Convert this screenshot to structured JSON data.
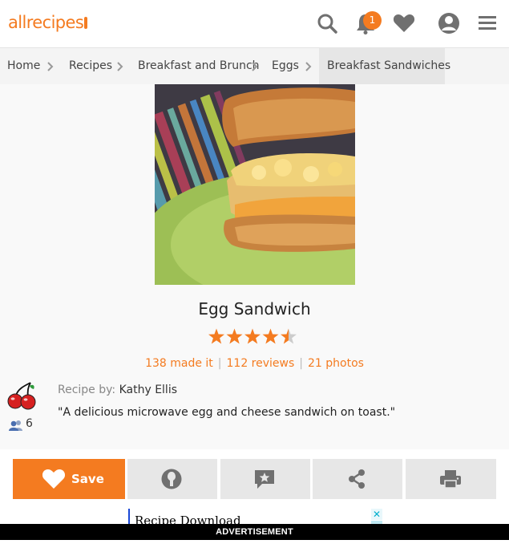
{
  "brand": {
    "logo_text": "allrecipes",
    "accent_color": "#f47b20"
  },
  "header": {
    "icons": [
      "search-icon",
      "bell-icon",
      "heart-icon",
      "user-icon",
      "menu-icon"
    ],
    "notification_count": "1"
  },
  "breadcrumb": {
    "items": [
      "Home",
      "Recipes",
      "Breakfast and Brunch",
      "Eggs",
      "Breakfast Sandwiches"
    ]
  },
  "recipe": {
    "title": "Egg Sandwich",
    "rating": 4.5,
    "rating_max": 5,
    "made_it": "138 made it",
    "reviews": "112 reviews",
    "photos": "21 photos",
    "author_label": "Recipe by:",
    "author_name": "Kathy Ellis",
    "followers": "6",
    "description": "\"A delicious microwave egg and cheese sandwich on toast.\""
  },
  "actions": {
    "save_label": "Save",
    "icons": [
      "heart-icon",
      "made-it-icon",
      "review-icon",
      "share-icon",
      "print-icon"
    ]
  },
  "ad": {
    "text": "Recipe Download",
    "close": "✕",
    "label": "ADVERTISEMENT"
  }
}
